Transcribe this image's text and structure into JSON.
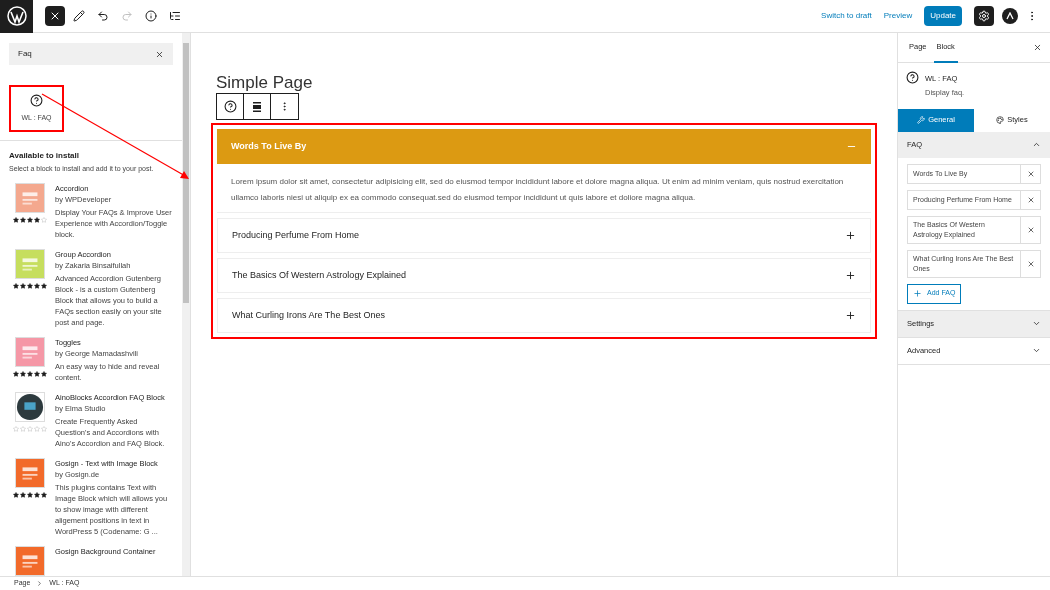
{
  "top_bar": {
    "tools": [
      {
        "kind": "close",
        "active": true,
        "disabled": false
      },
      {
        "kind": "edit",
        "active": false,
        "disabled": false
      },
      {
        "kind": "undo",
        "active": false,
        "disabled": false
      },
      {
        "kind": "redo",
        "active": false,
        "disabled": true
      },
      {
        "kind": "info",
        "active": false,
        "disabled": false
      },
      {
        "kind": "list",
        "active": false,
        "disabled": false
      }
    ],
    "switch_to_draft": "Switch to draft",
    "preview": "Preview",
    "update": "Update",
    "settings_active": true
  },
  "inserter": {
    "search": {
      "value": "Faq"
    },
    "result": {
      "label": "WL : FAQ"
    },
    "install_title": "Available to install",
    "install_hint": "Select a block to install and add it to your post.",
    "plugins": [
      {
        "name": "Accordion",
        "author": "by WPDeveloper",
        "description": "Display Your FAQs & Improve User Experience with Accordion/Toggle block.",
        "stars": 4,
        "color": "#f4a88e"
      },
      {
        "name": "Group Accordion",
        "author": "by Zakaria Binsaifullah",
        "description": "Advanced Accordion Gutenberg Block - is a custom Gutenberg Block that allows you to build a FAQs section easily on your site post and page.",
        "stars": 5,
        "color": "#c6de5e"
      },
      {
        "name": "Toggles",
        "author": "by George Mamadashvili",
        "description": "An easy way to hide and reveal content.",
        "stars": 5,
        "color": "#f597a6"
      },
      {
        "name": "AinoBlocks Accordion FAQ Block",
        "author": "by Elma Studio",
        "description": "Create Frequently Asked Question's and Accordions with Aino's Accordion and FAQ Block.",
        "stars": 0,
        "color": "#2d3a3e"
      },
      {
        "name": "Gosign - Text with Image Block",
        "author": "by Gosign.de",
        "description": "This plugins contains Text with Image Block which will allows you to show image with different aligement positions in text in WordPress 5 (Codename: G ...",
        "stars": 5,
        "color": "#f26a2a"
      },
      {
        "name": "Gosign Background Container",
        "color": "#f26a2a"
      }
    ]
  },
  "editor": {
    "page_title": "Simple Page",
    "accordion": [
      {
        "title": "Words To Live By",
        "expanded": true,
        "body": "Lorem ipsum dolor sit amet, consectetur adipisicing elit, sed do eiusmod tempor incididunt labore et dolore magna aliqua. Ut enim ad minim veniam, quis nostrud exercitation ullamco laboris niesi ut aliquip ex ea commodo consequat.sed do eiusmod tempor incididunt ut quis labore et doliore magna aliqua."
      },
      {
        "title": "Producing Perfume From Home",
        "expanded": false
      },
      {
        "title": "The Basics Of Western Astrology Explained",
        "expanded": false
      },
      {
        "title": "What Curling Irons Are The Best Ones",
        "expanded": false
      }
    ]
  },
  "settings_sidebar": {
    "tabs": [
      {
        "label": "Page",
        "selected": false
      },
      {
        "label": "Block",
        "selected": true
      }
    ],
    "block_name": "WL : FAQ",
    "block_description": "Display faq.",
    "panel_tabs": [
      {
        "label": "General",
        "kind": "wrench",
        "selected": true
      },
      {
        "label": "Styles",
        "kind": "palette",
        "selected": false
      }
    ],
    "sections": [
      {
        "title": "FAQ",
        "expanded": true,
        "items": [
          "Words To Live By",
          "Producing Perfume From Home",
          "The Basics Of Western Astrology Explained",
          "What Curling Irons Are The Best Ones"
        ],
        "add_label": "Add FAQ"
      },
      {
        "title": "Settings",
        "expanded": false
      },
      {
        "title": "Advanced",
        "expanded": false
      }
    ]
  },
  "breadcrumb": [
    "Page",
    "WL : FAQ"
  ]
}
